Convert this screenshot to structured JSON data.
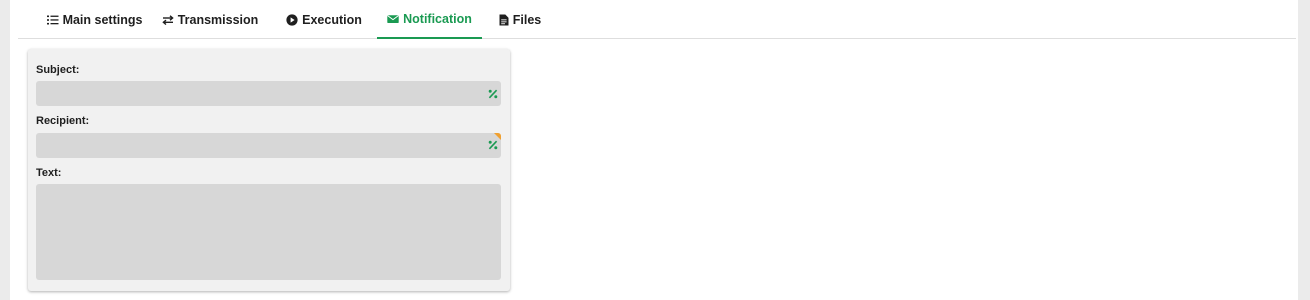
{
  "tabs": [
    {
      "label": "Main settings",
      "icon": "list-icon",
      "active": false
    },
    {
      "label": "Transmission",
      "icon": "swap-arrows-icon",
      "active": false
    },
    {
      "label": "Execution",
      "icon": "play-circle-icon",
      "active": false
    },
    {
      "label": "Notification",
      "icon": "envelope-icon",
      "active": true
    },
    {
      "label": "Files",
      "icon": "file-icon",
      "active": false
    }
  ],
  "colors": {
    "accent": "#1a9a52",
    "warning_corner": "#f0a030",
    "field_bg": "#d7d7d7",
    "card_bg": "#f1f1f1"
  },
  "form": {
    "subject_label": "Subject:",
    "subject_value": "",
    "recipient_label": "Recipient:",
    "recipient_value": "",
    "text_label": "Text:",
    "text_value": "",
    "placeholder_icon": "percent-icon"
  }
}
